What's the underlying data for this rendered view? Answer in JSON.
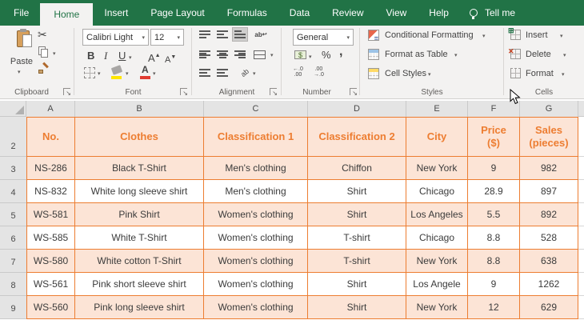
{
  "titlebar": {
    "tabs": [
      {
        "label": "File",
        "active": false
      },
      {
        "label": "Home",
        "active": true
      },
      {
        "label": "Insert",
        "active": false
      },
      {
        "label": "Page Layout",
        "active": false
      },
      {
        "label": "Formulas",
        "active": false
      },
      {
        "label": "Data",
        "active": false
      },
      {
        "label": "Review",
        "active": false
      },
      {
        "label": "View",
        "active": false
      },
      {
        "label": "Help",
        "active": false
      }
    ],
    "tell_me": "Tell me"
  },
  "ribbon": {
    "clipboard": {
      "label": "Clipboard",
      "paste": "Paste"
    },
    "font": {
      "label": "Font",
      "name": "Calibri Light",
      "size": "12",
      "bold": "B",
      "italic": "I",
      "underline": "U",
      "grow": "A",
      "shrink": "A"
    },
    "alignment": {
      "label": "Alignment",
      "wrap": "ab"
    },
    "number": {
      "label": "Number",
      "format": "General",
      "percent": "%",
      "comma": ",",
      "inc_decimal": "←.0\n.00",
      "dec_decimal": ".00\n→.0"
    },
    "styles": {
      "label": "Styles",
      "items": [
        "Conditional Formatting",
        "Format as Table",
        "Cell Styles"
      ]
    },
    "cells": {
      "label": "Cells",
      "items": [
        "Insert",
        "Delete",
        "Format"
      ]
    }
  },
  "sheet": {
    "column_letters": [
      "A",
      "B",
      "C",
      "D",
      "E",
      "F",
      "G"
    ],
    "header_row": {
      "number": "2",
      "cells": [
        "No.",
        "Clothes",
        "Classification 1",
        "Classification 2",
        "City",
        "Price ($)",
        "Sales (pieces)"
      ]
    },
    "rows": [
      {
        "number": "3",
        "cells": [
          "NS-286",
          "Black T-Shirt",
          "Men's clothing",
          "Chiffon",
          "New York",
          "9",
          "982"
        ]
      },
      {
        "number": "4",
        "cells": [
          "NS-832",
          "White long sleeve shirt",
          "Men's clothing",
          "Shirt",
          "Chicago",
          "28.9",
          "897"
        ]
      },
      {
        "number": "5",
        "cells": [
          "WS-581",
          "Pink Shirt",
          "Women's clothing",
          "Shirt",
          "Los Angeles",
          "5.5",
          "892"
        ]
      },
      {
        "number": "6",
        "cells": [
          "WS-585",
          "White T-Shirt",
          "Women's clothing",
          "T-shirt",
          "Chicago",
          "8.8",
          "528"
        ]
      },
      {
        "number": "7",
        "cells": [
          "WS-580",
          "White cotton T-Shirt",
          "Women's clothing",
          "T-shirt",
          "New York",
          "8.8",
          "638"
        ]
      },
      {
        "number": "8",
        "cells": [
          "WS-561",
          "Pink short sleeve shirt",
          "Women's clothing",
          "Shirt",
          "Los Angele",
          "9",
          "1262"
        ]
      },
      {
        "number": "9",
        "cells": [
          "WS-560",
          "Pink long sleeve shirt",
          "Women's clothing",
          "Shirt",
          "New York",
          "12",
          "629"
        ]
      }
    ],
    "colors": {
      "accent": "#ED7D31",
      "fill": "#FCE4D6"
    }
  }
}
